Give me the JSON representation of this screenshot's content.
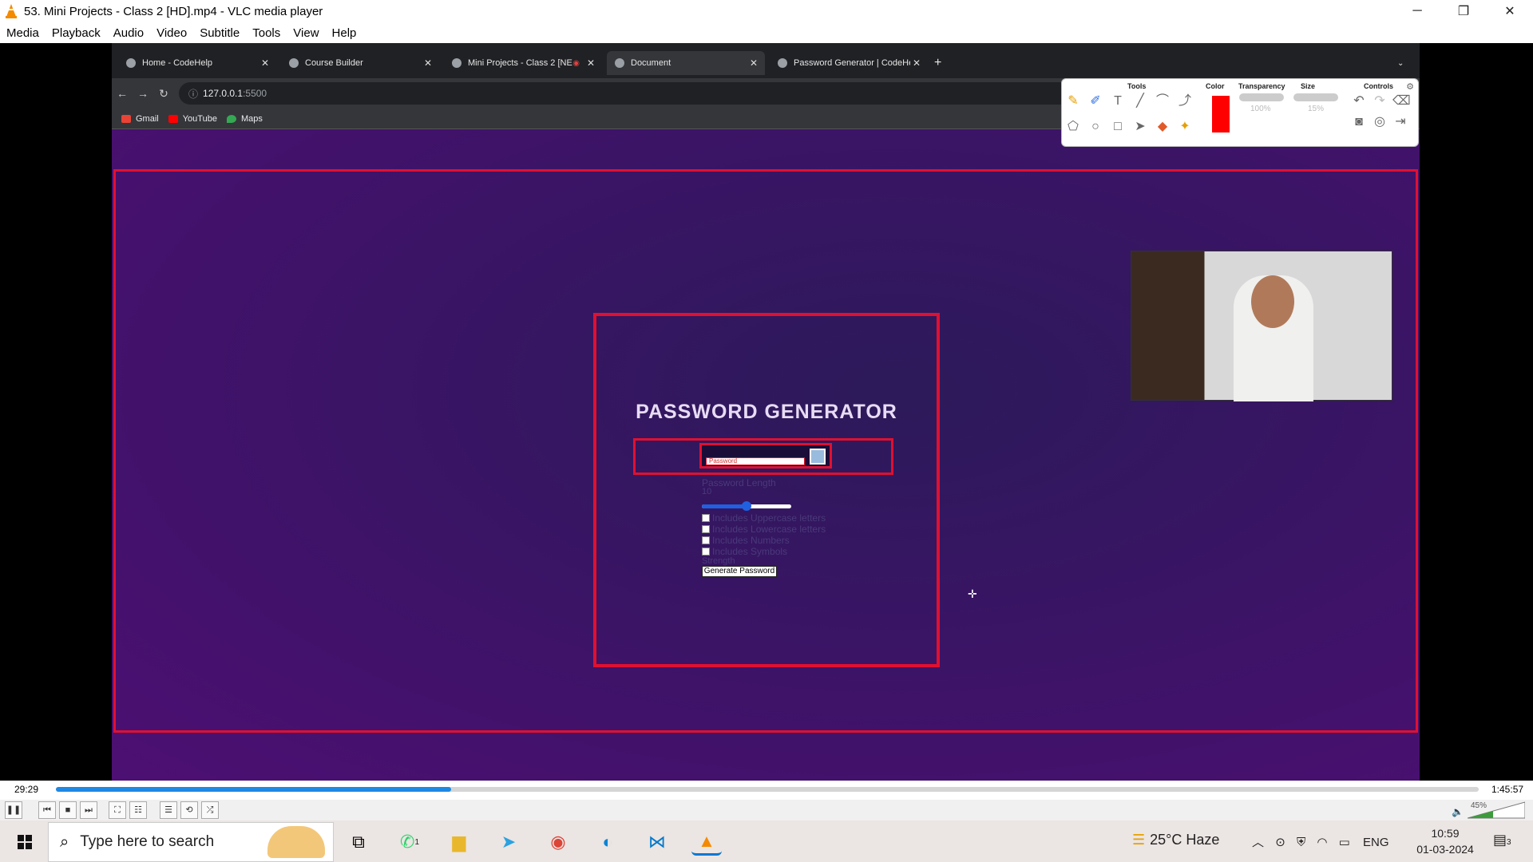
{
  "window": {
    "title": "53. Mini Projects - Class 2 [HD].mp4 - VLC media player",
    "controls": [
      "─",
      "❐",
      "✕"
    ]
  },
  "menu": [
    "Media",
    "Playback",
    "Audio",
    "Video",
    "Subtitle",
    "Tools",
    "View",
    "Help"
  ],
  "browser": {
    "tabs": [
      {
        "label": "Home - CodeHelp"
      },
      {
        "label": "Course Builder"
      },
      {
        "label": "Mini Projects - Class 2 [NE"
      },
      {
        "label": "Document"
      },
      {
        "label": "Password Generator | CodeHel"
      }
    ],
    "new_tab": "+",
    "url_host": "127.0.0.1",
    "url_port": ":5500",
    "bookmarks": [
      "Gmail",
      "YouTube",
      "Maps"
    ]
  },
  "page": {
    "title": "PASSWORD GENERATOR",
    "password_placeholder": "Password",
    "length_label": "Password Length",
    "length_value": "10",
    "slider_fraction": 0.5,
    "checkboxes": [
      "Includes Uppercase letters",
      "Includes Lowercase letters",
      "Includes Numbers",
      "Includes Symbols"
    ],
    "strength_label": "Strength",
    "generate_label": "Generate Password"
  },
  "annotation_toolbar": {
    "groups": [
      "Tools",
      "Color",
      "Transparency",
      "Size",
      "Controls"
    ],
    "transparency_value": "100%",
    "size_value": "15%",
    "color": "#ff0000"
  },
  "player": {
    "current_time": "29:29",
    "total_time": "1:45:57",
    "progress_fraction": 0.278,
    "volume": "45%"
  },
  "taskbar": {
    "search_placeholder": "Type here to search",
    "weather": "25°C  Haze",
    "language": "ENG",
    "time": "10:59",
    "date": "01-03-2024",
    "notifications": "3",
    "whatsapp_badge": "1"
  }
}
